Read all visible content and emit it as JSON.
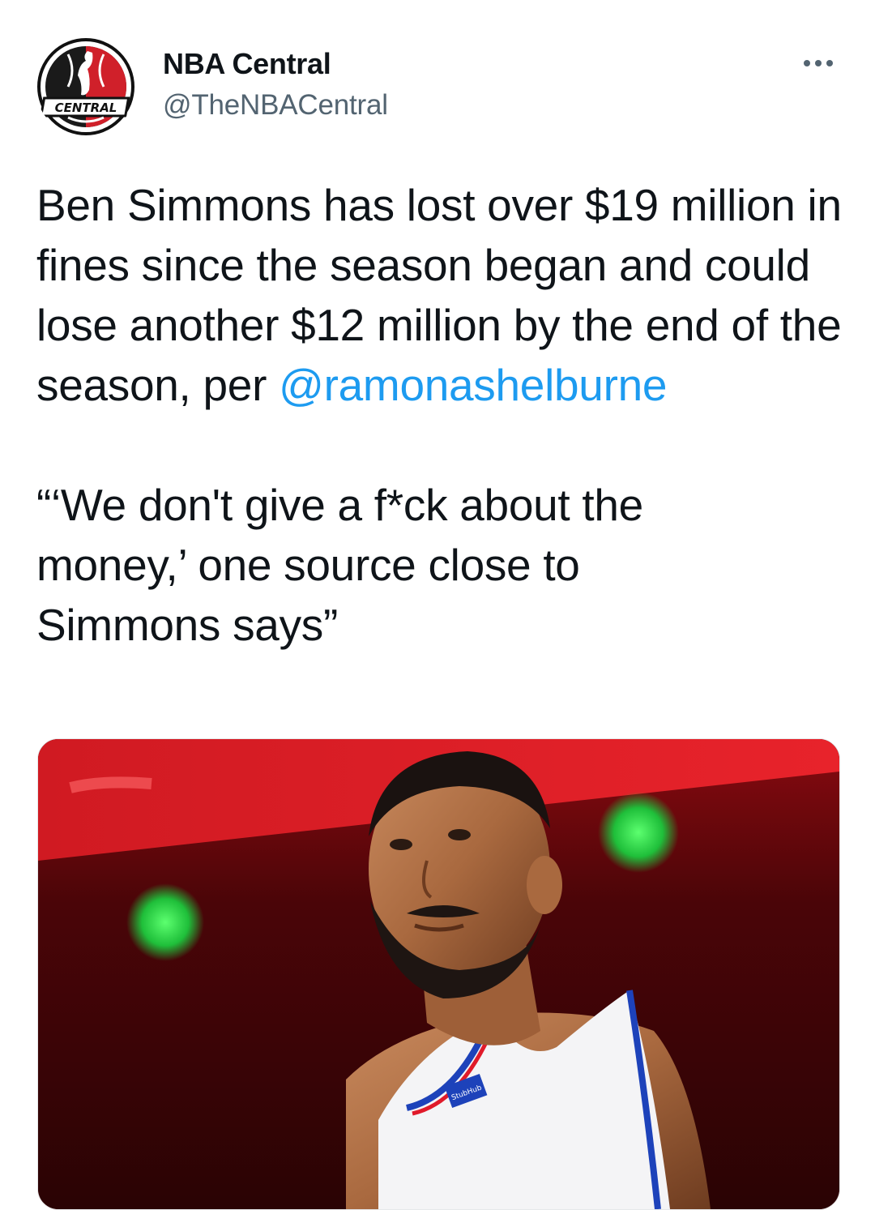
{
  "account": {
    "display_name": "NBA Central",
    "handle": "@TheNBACentral",
    "avatar_text": "CENTRAL",
    "avatar_icon": "nba-central-logo"
  },
  "more_icon": "more-horizontal-icon",
  "tweet": {
    "paragraph1": "Ben Simmons has lost over $19 million in fines since the season began and could lose another $12 million by the end of the season, per",
    "mention": "@ramonashelburne",
    "paragraph2_line1": "“‘We don't give a f*ck about the",
    "paragraph2_line2": "money,’ one source close to",
    "paragraph2_line3": "Simmons says”"
  },
  "media": {
    "jersey_patch": "StubHub",
    "colors": {
      "arena_red": "#c8151a",
      "background_dark": "#3a0406",
      "green_light": "#2fd14a",
      "jersey_white": "#f4f4f6",
      "trim_blue": "#1d42ba",
      "trim_red": "#e01a2a"
    }
  },
  "colors": {
    "text_primary": "#0f1419",
    "text_secondary": "#536471",
    "link": "#1d9bf0"
  }
}
